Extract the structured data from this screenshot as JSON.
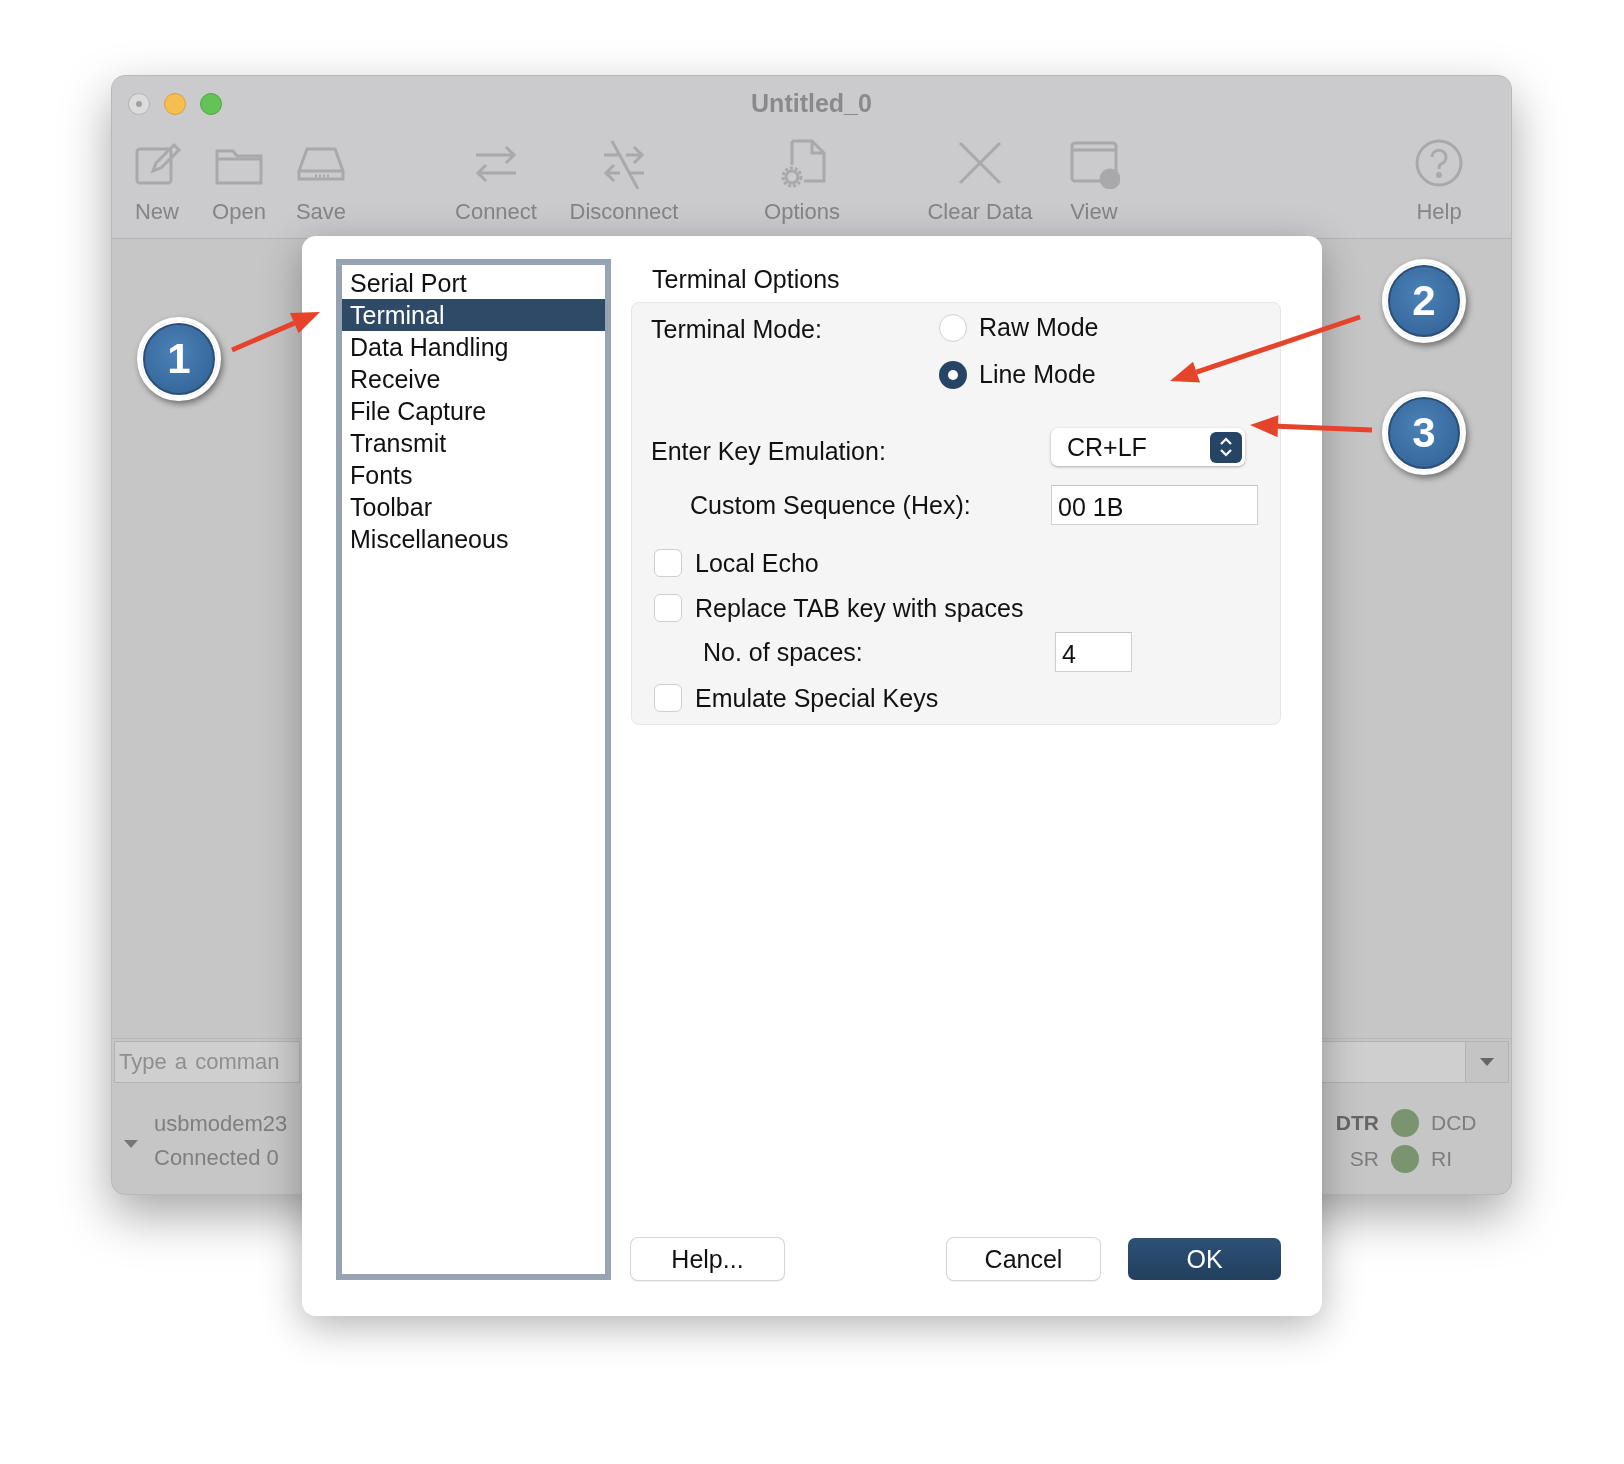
{
  "window": {
    "title": "Untitled_0"
  },
  "toolbar": [
    {
      "label": "New"
    },
    {
      "label": "Open"
    },
    {
      "label": "Save"
    },
    {
      "label": "Connect"
    },
    {
      "label": "Disconnect"
    },
    {
      "label": "Options"
    },
    {
      "label": "Clear Data"
    },
    {
      "label": "View"
    },
    {
      "label": "Help"
    }
  ],
  "command_field": {
    "placeholder": "Type a comman"
  },
  "status": {
    "port": "usbmodem23",
    "state": "Connected 0",
    "signals": [
      {
        "label": "DTR",
        "active": true
      },
      {
        "label": "SR",
        "active": false
      }
    ],
    "indicators": [
      {
        "label": "DCD",
        "lit": true
      },
      {
        "label": "RI",
        "lit": true
      }
    ]
  },
  "dialog": {
    "sidebar": [
      {
        "label": "Serial Port",
        "selected": false
      },
      {
        "label": "Terminal",
        "selected": true
      },
      {
        "label": "Data Handling",
        "selected": false
      },
      {
        "label": "Receive",
        "selected": false
      },
      {
        "label": "File Capture",
        "selected": false
      },
      {
        "label": "Transmit",
        "selected": false
      },
      {
        "label": "Fonts",
        "selected": false
      },
      {
        "label": "Toolbar",
        "selected": false
      },
      {
        "label": "Miscellaneous",
        "selected": false
      }
    ],
    "title": "Terminal Options",
    "terminal_mode": {
      "label": "Terminal Mode:",
      "options": [
        {
          "label": "Raw Mode",
          "selected": false
        },
        {
          "label": "Line Mode",
          "selected": true
        }
      ]
    },
    "enter_key": {
      "label": "Enter Key Emulation:",
      "value": "CR+LF"
    },
    "custom_sequence": {
      "label": "Custom Sequence (Hex):",
      "value": "00 1B"
    },
    "local_echo": {
      "label": "Local Echo",
      "checked": false
    },
    "replace_tab": {
      "label": "Replace TAB key with spaces",
      "checked": false
    },
    "spaces": {
      "label": "No. of spaces:",
      "value": "4"
    },
    "emulate_keys": {
      "label": "Emulate Special Keys",
      "checked": false
    },
    "buttons": [
      {
        "label": "Help...",
        "kind": "normal"
      },
      {
        "label": "Cancel",
        "kind": "normal"
      },
      {
        "label": "OK",
        "kind": "default"
      }
    ]
  },
  "callouts": [
    {
      "label": "1"
    },
    {
      "label": "2"
    },
    {
      "label": "3"
    }
  ]
}
